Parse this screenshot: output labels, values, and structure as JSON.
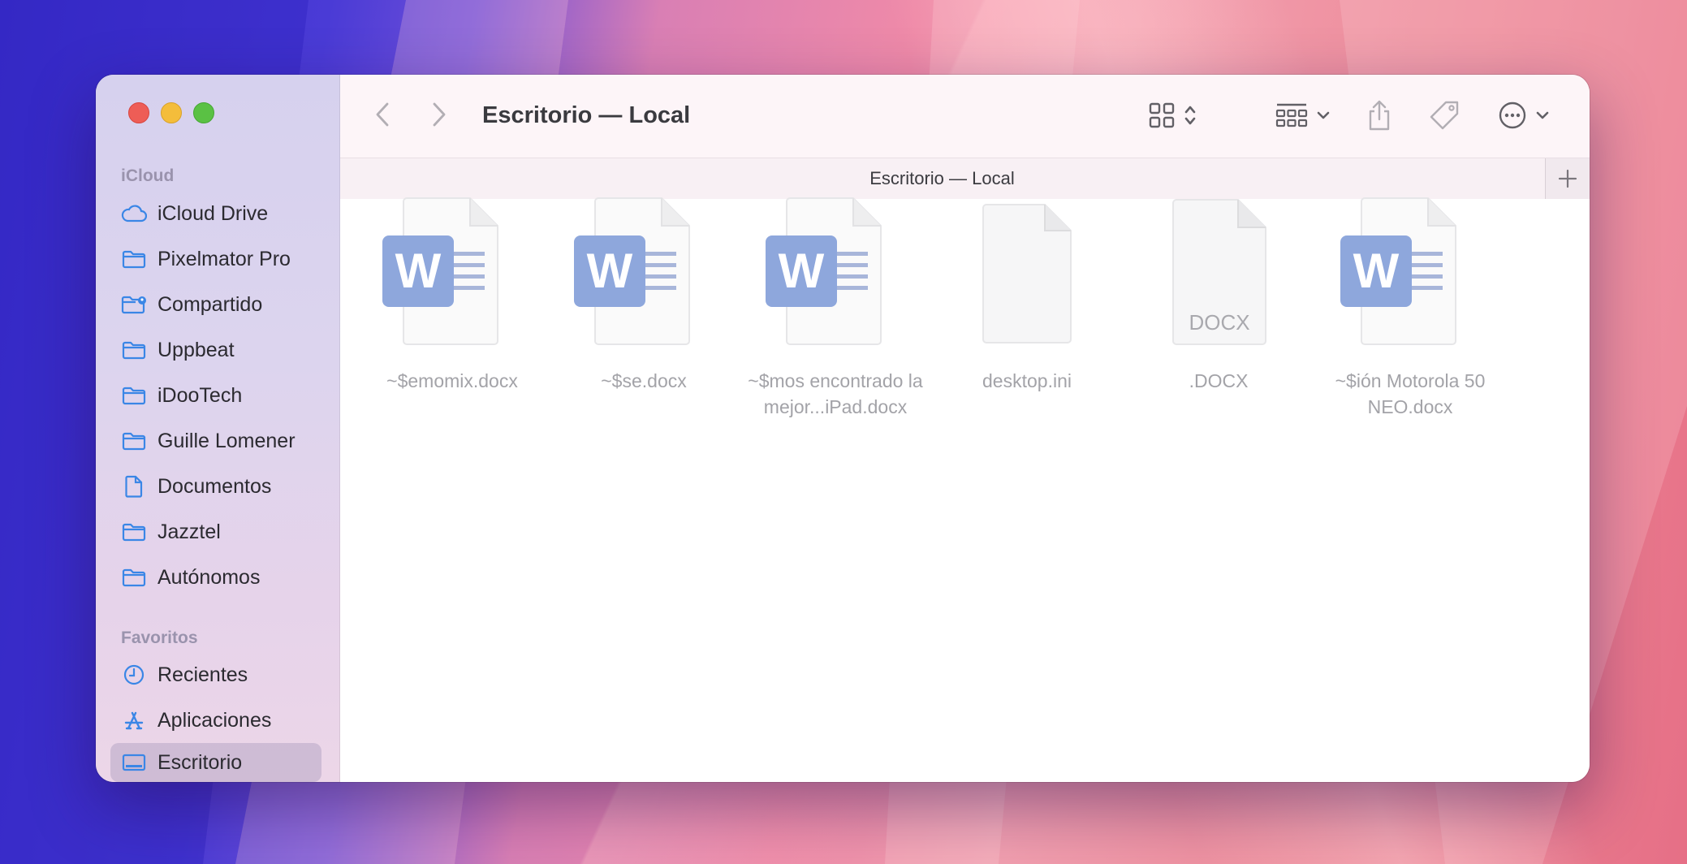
{
  "window": {
    "title": "Escritorio — Local"
  },
  "tab": {
    "label": "Escritorio — Local"
  },
  "sidebar": {
    "sections": [
      {
        "header": "iCloud",
        "items": [
          {
            "label": "iCloud Drive",
            "icon": "cloud-icon"
          },
          {
            "label": "Pixelmator Pro",
            "icon": "folder-icon"
          },
          {
            "label": "Compartido",
            "icon": "shared-folder-icon"
          },
          {
            "label": "Uppbeat",
            "icon": "folder-icon"
          },
          {
            "label": "iDooTech",
            "icon": "folder-icon"
          },
          {
            "label": "Guille Lomener",
            "icon": "folder-icon"
          },
          {
            "label": "Documentos",
            "icon": "document-icon"
          },
          {
            "label": "Jazztel",
            "icon": "folder-icon"
          },
          {
            "label": "Autónomos",
            "icon": "folder-icon"
          }
        ]
      },
      {
        "header": "Favoritos",
        "items": [
          {
            "label": "Recientes",
            "icon": "clock-icon"
          },
          {
            "label": "Aplicaciones",
            "icon": "apps-icon"
          },
          {
            "label": "Escritorio",
            "icon": "desktop-icon",
            "selected": true
          }
        ]
      }
    ]
  },
  "files": [
    {
      "name": "~$emomix.docx",
      "icon": "word-document-icon"
    },
    {
      "name": "~$se.docx",
      "icon": "word-document-icon"
    },
    {
      "name": "~$mos encontrado la mejor...iPad.docx",
      "icon": "word-document-icon"
    },
    {
      "name": "desktop.ini",
      "icon": "blank-document-icon"
    },
    {
      "name": ".DOCX",
      "icon": "generic-docx-icon",
      "badge": "DOCX"
    },
    {
      "name": "~$ión Motorola 50 NEO.docx",
      "icon": "word-document-icon"
    }
  ],
  "word_badge_letter": "W",
  "colors": {
    "accent": "#2f7ae0",
    "word_blue": "#8ea7dc",
    "sidebar_icon": "#3a86e6"
  }
}
